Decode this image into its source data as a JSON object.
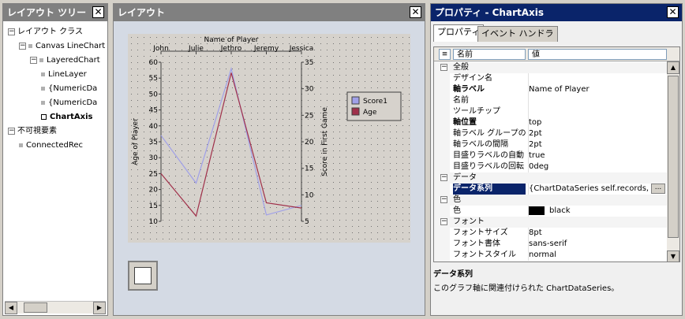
{
  "tree_pane": {
    "title": "レイアウト ツリー",
    "nodes": [
      {
        "label": "レイアウト クラス",
        "depth": 0,
        "expander": "⊟",
        "icon": "none"
      },
      {
        "label": "Canvas LineChart",
        "depth": 1,
        "expander": "⊟",
        "icon": "node"
      },
      {
        "label": "LayeredChart",
        "depth": 2,
        "expander": "⊟",
        "icon": "node"
      },
      {
        "label": "LineLayer",
        "depth": 3,
        "expander": "",
        "icon": "node"
      },
      {
        "label": "{NumericDa",
        "depth": 3,
        "expander": "",
        "icon": "node"
      },
      {
        "label": "{NumericDa",
        "depth": 3,
        "expander": "",
        "icon": "node"
      },
      {
        "label": "ChartAxis",
        "depth": 3,
        "expander": "",
        "icon": "sel",
        "bold": true
      },
      {
        "label": "不可視要素",
        "depth": 0,
        "expander": "⊟",
        "icon": "none"
      },
      {
        "label": "ConnectedRec",
        "depth": 1,
        "expander": "",
        "icon": "node"
      }
    ]
  },
  "layout_pane": {
    "title": "レイアウト"
  },
  "chart_data": {
    "type": "line",
    "title": "Name of Player",
    "categories": [
      "John",
      "Julie",
      "Jethro",
      "Jeremy",
      "Jessica"
    ],
    "ylabel_left": "Age of Player",
    "ylabel_right": "Score in First Game",
    "ylim_left": [
      10,
      60
    ],
    "ylim_right": [
      5,
      35
    ],
    "yticks_left": [
      10,
      15,
      20,
      25,
      30,
      35,
      40,
      45,
      50,
      55,
      60
    ],
    "yticks_right": [
      5,
      10,
      15,
      20,
      25,
      30,
      35
    ],
    "series": [
      {
        "name": "Score1",
        "axis": "left",
        "color": "#a0a0e8",
        "values": [
          37,
          22,
          58,
          12,
          15
        ]
      },
      {
        "name": "Age",
        "axis": "right",
        "color": "#a0304a",
        "values": [
          14,
          6,
          33,
          8.5,
          7.5
        ]
      }
    ],
    "grid": true,
    "legend": "right"
  },
  "props_pane": {
    "title": "プロパティ - ChartAxis",
    "tabs": [
      "プロパティ",
      "イベント ハンドラ"
    ],
    "header": {
      "sort_icon": "≡",
      "name_col": "名前",
      "value_col": "値"
    },
    "rows": [
      {
        "kind": "section",
        "label": "全般"
      },
      {
        "kind": "prop",
        "name": "デザイン名",
        "value": ""
      },
      {
        "kind": "prop",
        "name": "軸ラベル",
        "value": "Name of Player",
        "bold": true
      },
      {
        "kind": "prop",
        "name": "名前",
        "value": ""
      },
      {
        "kind": "prop",
        "name": "ツールチップ",
        "value": ""
      },
      {
        "kind": "prop",
        "name": "軸位置",
        "value": "top",
        "bold": true
      },
      {
        "kind": "prop",
        "name": "軸ラベル グループの",
        "value": "2pt"
      },
      {
        "kind": "prop",
        "name": "軸ラベルの間隔",
        "value": "2pt"
      },
      {
        "kind": "prop",
        "name": "目盛りラベルの自動",
        "value": "true"
      },
      {
        "kind": "prop",
        "name": "目盛りラベルの回転",
        "value": "0deg"
      },
      {
        "kind": "section",
        "label": "データ"
      },
      {
        "kind": "prop",
        "name": "データ系列",
        "value": "{ChartDataSeries self.records,",
        "bold": true,
        "selected": true,
        "ellipsis": "..."
      },
      {
        "kind": "section",
        "label": "色"
      },
      {
        "kind": "prop",
        "name": "色",
        "value": "black",
        "swatch": "#000000"
      },
      {
        "kind": "section",
        "label": "フォント"
      },
      {
        "kind": "prop",
        "name": "フォントサイズ",
        "value": "8pt"
      },
      {
        "kind": "prop",
        "name": "フォント書体",
        "value": "sans-serif"
      },
      {
        "kind": "prop",
        "name": "フォントスタイル",
        "value": "normal"
      }
    ],
    "description": {
      "title": "データ系列",
      "text": "このグラフ軸に関連付けられた ChartDataSeries。"
    }
  },
  "colors": {
    "active_title": "#0a246a",
    "inactive_title": "#808080",
    "chart_bg": "#d6d2cc"
  }
}
